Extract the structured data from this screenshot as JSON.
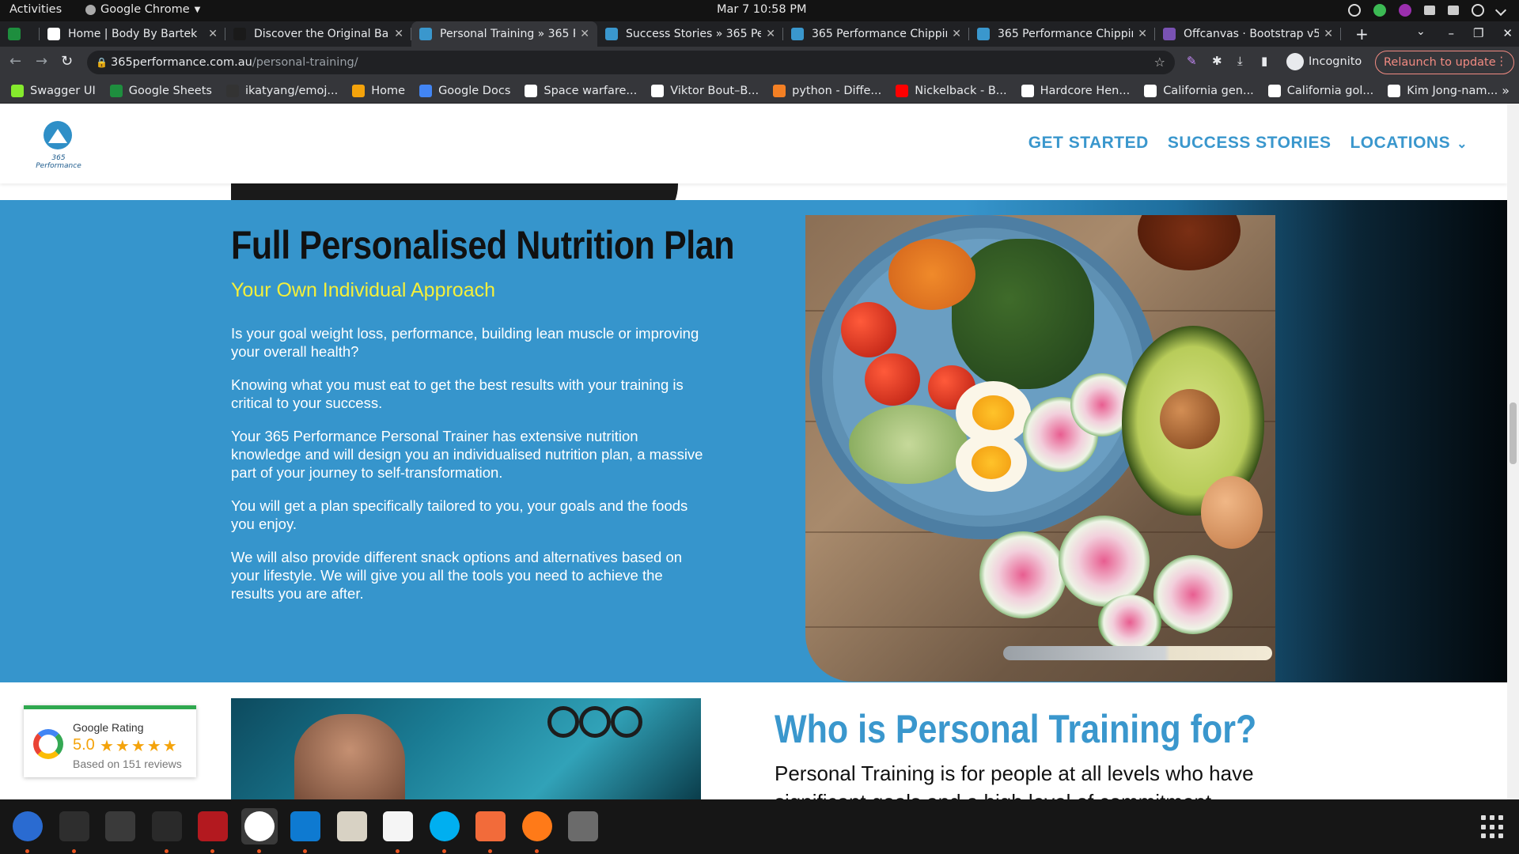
{
  "system": {
    "activities": "Activities",
    "app_menu": "Google Chrome",
    "clock": "Mar 7  10:58 PM"
  },
  "tabs": [
    {
      "title": "",
      "favicon_color": "#1e8e3e",
      "active": false
    },
    {
      "title": "Home | Body By Bartek",
      "favicon_color": "#ffffff",
      "active": false
    },
    {
      "title": "Discover the Original Bar",
      "favicon_color": "#1a1a1a",
      "active": false
    },
    {
      "title": "Personal Training » 365 Pe",
      "favicon_color": "#3a97cd",
      "active": true
    },
    {
      "title": "Success Stories » 365 Perf",
      "favicon_color": "#3a97cd",
      "active": false
    },
    {
      "title": "365 Performance Chippin",
      "favicon_color": "#3a97cd",
      "active": false
    },
    {
      "title": "365 Performance Chippin",
      "favicon_color": "#3a97cd",
      "active": false
    },
    {
      "title": "Offcanvas · Bootstrap v5",
      "favicon_color": "#7952b3",
      "active": false
    }
  ],
  "omnibox": {
    "domain": "365performance.com.au",
    "path": "/personal-training/"
  },
  "incognito_label": "Incognito",
  "relaunch_label": "Relaunch to update",
  "bookmarks": [
    {
      "label": "Swagger UI",
      "color": "#85ea2d"
    },
    {
      "label": "Google Sheets",
      "color": "#1e8e3e"
    },
    {
      "label": "ikatyang/emoj...",
      "color": "#333333"
    },
    {
      "label": "Home",
      "color": "#f4a30b"
    },
    {
      "label": "Google Docs",
      "color": "#4285f4"
    },
    {
      "label": "Space warfare...",
      "color": "#ffffff"
    },
    {
      "label": "Viktor Bout–B...",
      "color": "#ffffff"
    },
    {
      "label": "python - Diffe...",
      "color": "#f48024"
    },
    {
      "label": "Nickelback - B...",
      "color": "#ff0000"
    },
    {
      "label": "Hardcore Hen...",
      "color": "#ffffff"
    },
    {
      "label": "California gen...",
      "color": "#ffffff"
    },
    {
      "label": "California gol...",
      "color": "#ffffff"
    },
    {
      "label": "Kim Jong-nam...",
      "color": "#ffffff"
    }
  ],
  "site": {
    "logo_text": "365 Performance",
    "nav": {
      "get_started": "GET STARTED",
      "success_stories": "SUCCESS STORIES",
      "locations": "LOCATIONS"
    },
    "nutrition": {
      "title": "Full Personalised Nutrition Plan",
      "subtitle": "Your Own Individual Approach",
      "paragraphs": [
        "Is your goal weight loss, performance, building lean muscle or improving your overall health?",
        "Knowing what you must eat to get the best results with your training is critical to your success.",
        "Your 365 Performance Personal Trainer has extensive nutrition knowledge and will design you an individualised nutrition plan, a massive part of your journey to self-transformation.",
        "You will get a plan specifically tailored to you, your goals and the foods you enjoy.",
        "We will also provide different snack options and alternatives based on your lifestyle. We will give you all the tools you need to achieve the results you are after."
      ]
    },
    "rating": {
      "label": "Google Rating",
      "score": "5.0",
      "stars": "★★★★★",
      "reviews": "Based on 151 reviews"
    },
    "who": {
      "title": "Who is Personal Training for?",
      "line1": "Personal Training is for people at all levels who have",
      "line2": "significant goals and a high level of commitment"
    }
  },
  "colors": {
    "brand_blue": "#3a97cd",
    "subtitle_yellow": "#f5ef3a",
    "relaunch_red": "#f28b82"
  },
  "dock_apps": [
    "thunderbird-icon",
    "terminal-icon",
    "calculator-icon",
    "system-monitor-icon",
    "filezilla-icon",
    "chrome-icon",
    "vscode-icon",
    "files-icon",
    "text-editor-icon",
    "skype-icon",
    "postman-icon",
    "firefox-dev-icon",
    "disks-icon"
  ]
}
